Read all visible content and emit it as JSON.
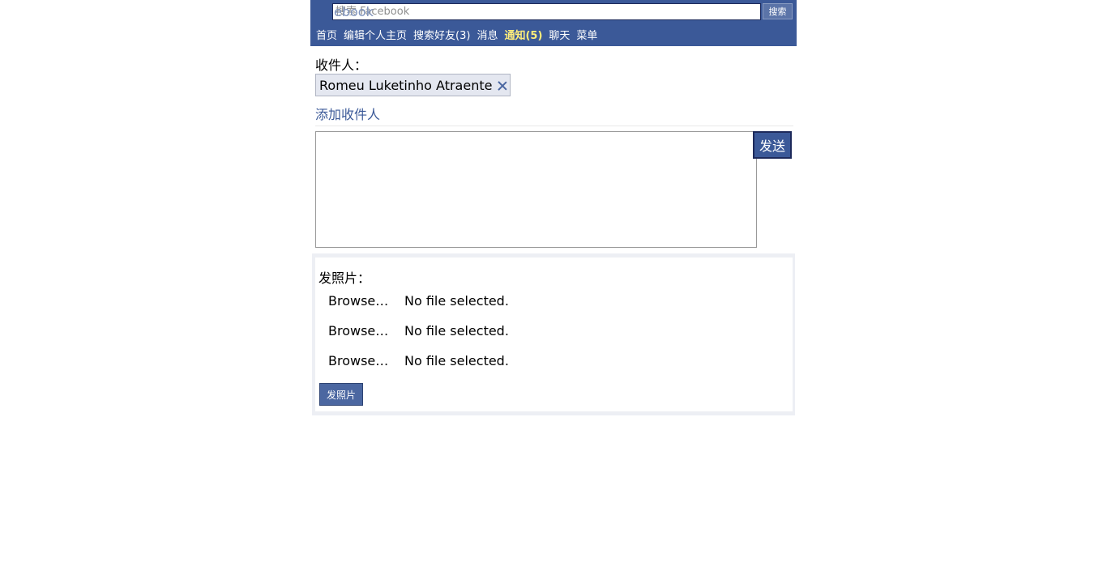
{
  "header": {
    "logo_text": "ebook",
    "search_placeholder": "搜索 Facebook",
    "search_button_label": "搜索",
    "nav": {
      "home": "首页",
      "edit_profile": "编辑个人主页",
      "find_friends": "搜索好友(3)",
      "messages": "消息",
      "notifications": "通知(5)",
      "chat": "聊天",
      "menu": "菜单"
    }
  },
  "compose": {
    "to_label": "收件人：",
    "recipient_name": "Romeu Luketinho Atraente",
    "add_recipient_label": "添加收件人",
    "message_value": "",
    "send_label": "发送"
  },
  "photos": {
    "label": "发照片：",
    "files": [
      {
        "browse_label": "Browse…",
        "status": "No file selected."
      },
      {
        "browse_label": "Browse…",
        "status": "No file selected."
      },
      {
        "browse_label": "Browse…",
        "status": "No file selected."
      }
    ],
    "submit_label": "发照片"
  },
  "colors": {
    "header_bg": "#3b5998",
    "link": "#3b5998",
    "notification_highlight": "#ffed7a",
    "chip_bg": "#e4e7f0",
    "photo_section_bg": "#edeff4"
  }
}
